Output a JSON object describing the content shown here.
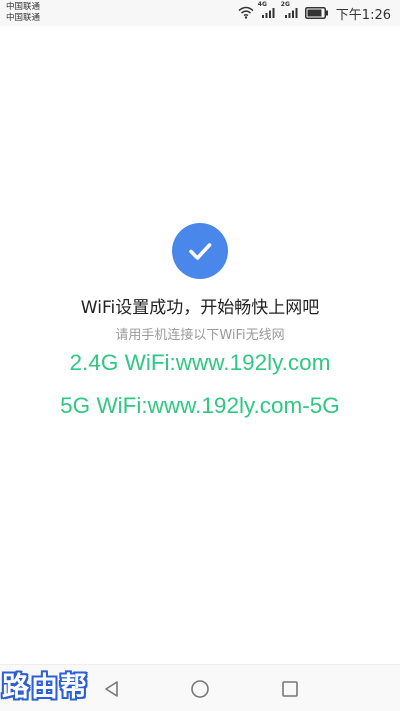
{
  "status_bar": {
    "carrier_1": "中国联通",
    "carrier_2": "中国联通",
    "network_1": "4G",
    "network_2": "2G",
    "time": "下午1:26"
  },
  "main": {
    "title": "WiFi设置成功，开始畅快上网吧",
    "subtitle": "请用手机连接以下WiFi无线网",
    "wifi_24g": "2.4G WiFi:www.192ly.com",
    "wifi_5g": "5G WiFi:www.192ly.com-5G"
  },
  "watermark": {
    "text": "路由帮"
  },
  "colors": {
    "accent_blue": "#4a87ea",
    "wifi_green": "#2fc882",
    "watermark_blue": "#2c5fd6"
  },
  "icons": {
    "wifi": "wifi-icon",
    "signal": "signal-icon",
    "battery": "battery-icon",
    "check": "check-icon",
    "back": "back-triangle-icon",
    "home": "home-circle-icon",
    "recent": "recent-square-icon"
  }
}
